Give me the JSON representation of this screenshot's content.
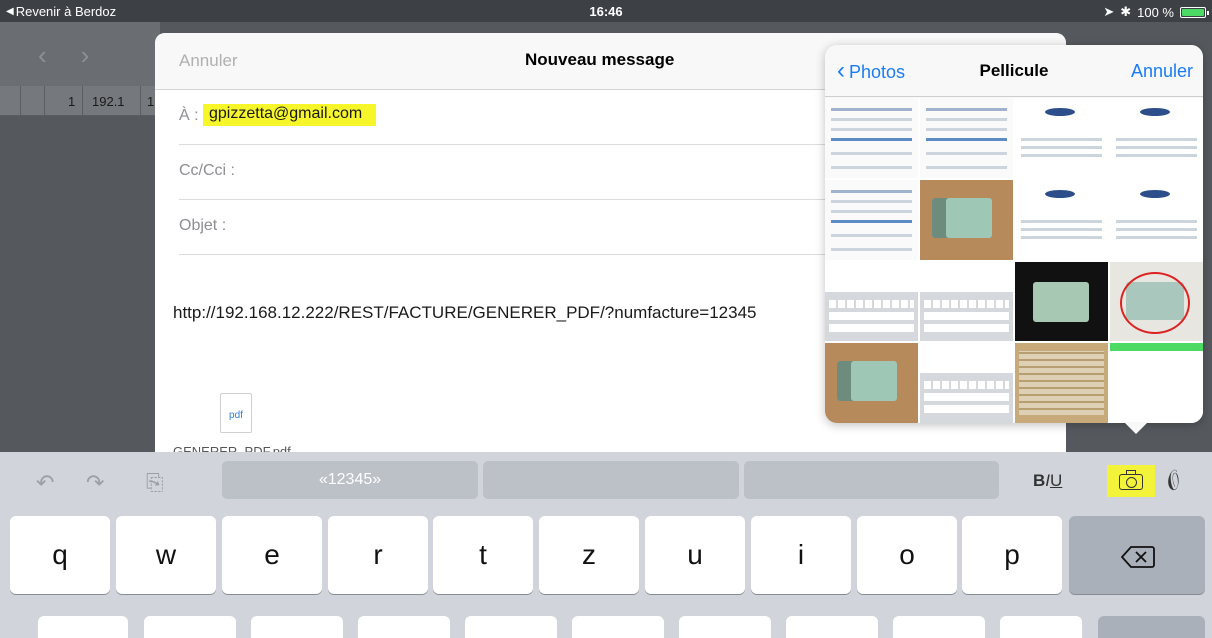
{
  "status_bar": {
    "back_label": "Revenir à Berdoz",
    "time": "16:46",
    "battery": "100 %"
  },
  "background_app": {
    "row_values": [
      "1",
      "192.1",
      "1"
    ]
  },
  "compose": {
    "cancel_label": "Annuler",
    "title": "Nouveau message",
    "to_label": "À :",
    "to_value": "gpizzetta@gmail.com",
    "cc_label": "Cc/Cci :",
    "subject_label": "Objet :",
    "body_url": "http://192.168.12.222/REST/FACTURE/GENERER_PDF/?numfacture=12345",
    "attachment_icon_label": "pdf",
    "attachment_name": "GENERER_PDF.pdf"
  },
  "photos_popover": {
    "back_label": "Photos",
    "title": "Pellicule",
    "cancel_label": "Annuler"
  },
  "shortcut_bar": {
    "suggestion": "«12345»",
    "bold": "B",
    "italic": "I",
    "underline": "U"
  },
  "keyboard": {
    "row1": [
      "q",
      "w",
      "e",
      "r",
      "t",
      "z",
      "u",
      "i",
      "o",
      "p"
    ]
  },
  "colors": {
    "highlight": "#f6f62a",
    "ios_blue": "#1a7cf5",
    "keyboard_bg": "#d1d5db"
  }
}
